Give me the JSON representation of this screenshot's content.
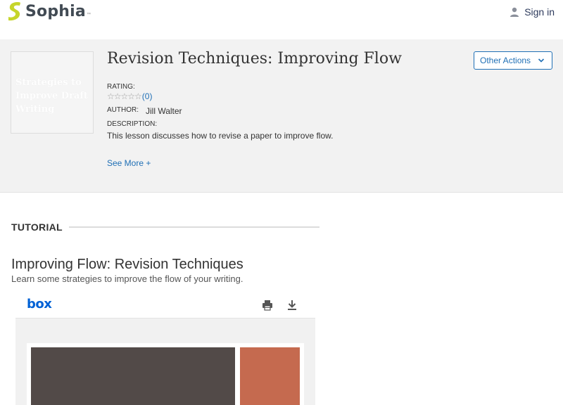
{
  "header": {
    "brand": "Sophia",
    "signin_label": "Sign in"
  },
  "hero": {
    "thumbnail_text": "Strategies to Improve Draft Writing",
    "title": "Revision Techniques: Improving Flow",
    "other_actions_label": "Other Actions",
    "rating_label": "RATING:",
    "rating_stars": "☆☆☆☆☆",
    "rating_count": "(0)",
    "author_label": "AUTHOR:",
    "author_name": "Jill Walter",
    "description_label": "DESCRIPTION:",
    "description": "This lesson discusses how to revise a paper to improve flow.",
    "see_more": "See More +"
  },
  "tutorial": {
    "section_label": "TUTORIAL",
    "title": "Improving Flow: Revision Techniques",
    "subtitle": "Learn some strategies to improve the flow of your writing."
  },
  "viewer": {
    "brand": "box"
  },
  "colors": {
    "accent": "#1f6fb5",
    "brand_green": "#c6d52b",
    "box_blue": "#0061d5",
    "slide_dark": "#524a48",
    "slide_orange": "#c56a4f"
  }
}
